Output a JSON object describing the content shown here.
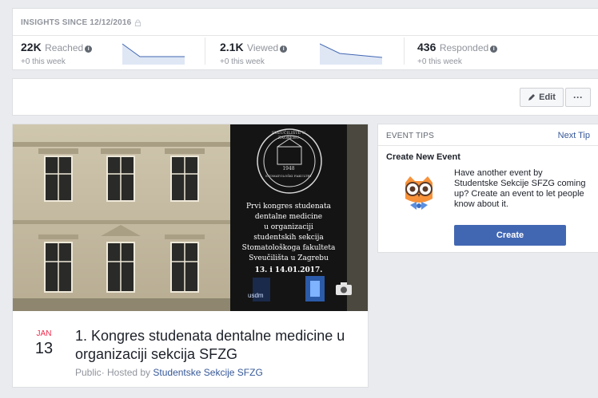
{
  "insights": {
    "header": "INSIGHTS SINCE 12/12/2016",
    "stats": [
      {
        "value": "22K",
        "label": "Reached",
        "sub": "+0 this week"
      },
      {
        "value": "2.1K",
        "label": "Viewed",
        "sub": "+0 this week"
      },
      {
        "value": "436",
        "label": "Responded",
        "sub": "+0 this week"
      }
    ]
  },
  "toolbar": {
    "edit_label": "Edit",
    "more_label": "···"
  },
  "event": {
    "month": "JAN",
    "day": "13",
    "title": "1. Kongres studenata dentalne medicine u organizaciji sekcija SFZG",
    "visibility": "Public",
    "hosted_prefix": "· Hosted by ",
    "host": "Studentske Sekcije SFZG",
    "cover": {
      "seal_lines": [
        "SVEUČILIŠTE U ZAGREBU",
        "STOMATOLOŠKI FAKULTET",
        "1948"
      ],
      "lines": [
        "Prvi kongres studenata",
        "dentalne medicine",
        "u organizaciji",
        "studentskih sekcija",
        "Stomatološkoga fakulteta",
        "Sveučilišta u Zagrebu"
      ],
      "dates": "13. i 14.01.2017.",
      "logo_text": "usdm"
    }
  },
  "tips": {
    "header": "EVENT TIPS",
    "next": "Next Tip",
    "title": "Create New Event",
    "text": "Have another event by Studentske Sekcije SFZG coming up? Create an event to let people know about it.",
    "button": "Create"
  },
  "colors": {
    "accent": "#4267b2",
    "link": "#365899",
    "date_month": "#f02849",
    "spark": "#4267b2"
  },
  "icons": [
    "lock-icon",
    "info-icon",
    "pencil-icon",
    "camera-icon",
    "owl-icon"
  ]
}
